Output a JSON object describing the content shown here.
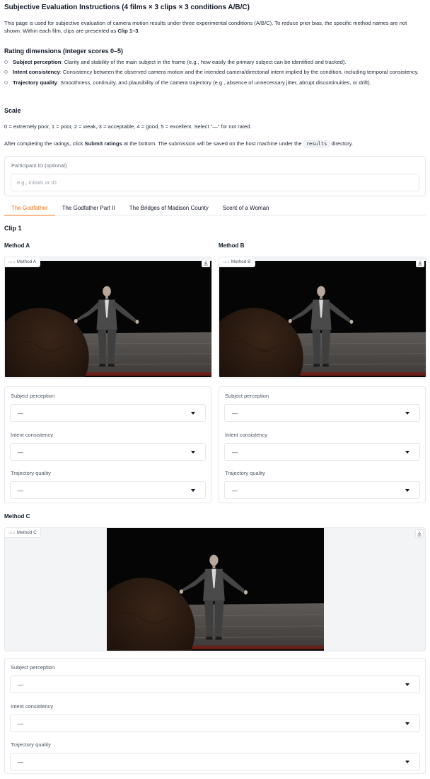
{
  "header": {
    "title": "Subjective Evaluation Instructions (4 films × 3 clips × 3 conditions A/B/C)",
    "intro_1": "This page is used for subjective evaluation of camera motion results under three experimental conditions (A/B/C). To reduce prior bias, the specific method names are not shown. Within each film, clips are presented as ",
    "intro_bold": "Clip 1–3",
    "intro_2": "."
  },
  "rating_dimensions": {
    "heading": "Rating dimensions (integer scores 0–5)",
    "items": [
      {
        "name": "Subject perception",
        "desc": ": Clarity and stability of the main subject in the frame (e.g., how easily the primary subject can be identified and tracked)."
      },
      {
        "name": "Intent consistency",
        "desc": ": Consistency between the observed camera motion and the intended camera/directorial intent implied by the condition, including temporal consistency."
      },
      {
        "name": "Trajectory quality",
        "desc": ": Smoothness, continuity, and plausibility of the camera trajectory (e.g., absence of unnecessary jitter, abrupt discontinuities, or drift)."
      }
    ]
  },
  "scale": {
    "heading": "Scale",
    "text": "0 = extremely poor, 1 = poor, 2 = weak, 3 = acceptable, 4 = good, 5 = excellent. Select “—” for not rated."
  },
  "submit_note": {
    "before": "After completing the ratings, click ",
    "bold": "Submit ratings",
    "middle": " at the bottom. The submission will be saved on the host machine under the ",
    "code": "results",
    "after": " directory."
  },
  "participant": {
    "label": "Participant ID (optional)",
    "placeholder": "e.g., initials or ID"
  },
  "tabs": [
    {
      "label": "The Godfather",
      "active": true
    },
    {
      "label": "The Godfather Part II",
      "active": false
    },
    {
      "label": "The Bridges of Madison County",
      "active": false
    },
    {
      "label": "Scent of a Woman",
      "active": false
    }
  ],
  "clip": {
    "title": "Clip 1",
    "methods": [
      {
        "label": "Method A",
        "video_tag": "Method A",
        "ratings": [
          {
            "label": "Subject perception",
            "value": "—"
          },
          {
            "label": "Intent consistency",
            "value": "—"
          },
          {
            "label": "Trajectory quality",
            "value": "—"
          }
        ]
      },
      {
        "label": "Method B",
        "video_tag": "Method B",
        "ratings": [
          {
            "label": "Subject perception",
            "value": "—"
          },
          {
            "label": "Intent consistency",
            "value": "—"
          },
          {
            "label": "Trajectory quality",
            "value": "—"
          }
        ]
      },
      {
        "label": "Method C",
        "video_tag": "Method C",
        "ratings": [
          {
            "label": "Subject perception",
            "value": "—"
          },
          {
            "label": "Intent consistency",
            "value": "—"
          },
          {
            "label": "Trajectory quality",
            "value": "—"
          }
        ]
      }
    ]
  },
  "icons": {
    "camera": "camera-icon",
    "download": "download-icon",
    "dropdown": "chevron-down-icon"
  },
  "colors": {
    "accent": "#f97316",
    "border": "#e5e7eb",
    "text": "#1f2937"
  }
}
